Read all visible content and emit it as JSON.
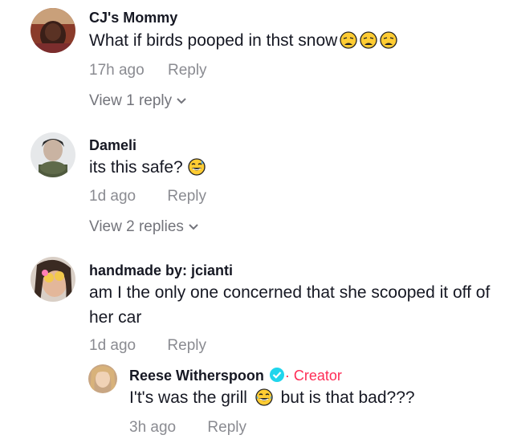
{
  "comments": [
    {
      "username": "CJ's Mommy",
      "text": "What if birds pooped in thst snow",
      "emojis": [
        "weary-face",
        "weary-face",
        "weary-face"
      ],
      "time": "17h ago",
      "reply_label": "Reply",
      "view_replies": "View 1 reply"
    },
    {
      "username": "Dameli",
      "text": "its this safe?",
      "emojis": [
        "grinning-sweat-face"
      ],
      "time": "1d ago",
      "reply_label": "Reply",
      "view_replies": "View 2 replies"
    },
    {
      "username": "handmade by: jcianti",
      "text": "am I the only one concerned that she scooped it off of her car",
      "time": "1d ago",
      "reply_label": "Reply"
    }
  ],
  "reply": {
    "username": "Reese Witherspoon",
    "creator_label": "· Creator",
    "text_before": "I't's was the grill",
    "emoji": "tears-of-joy-face",
    "text_after": "but is that bad???",
    "time": "3h ago",
    "reply_label": "Reply"
  },
  "colors": {
    "accent_creator": "#fe2c55",
    "verified": "#20d5ec",
    "muted": "#8a8b91"
  }
}
